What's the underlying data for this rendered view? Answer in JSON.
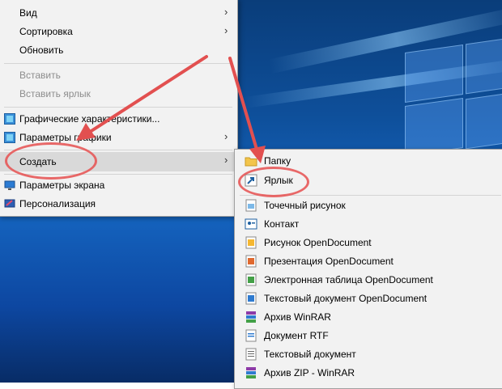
{
  "context_menu": {
    "items": [
      {
        "label": "Вид",
        "submenu": true,
        "disabled": false,
        "icon": null
      },
      {
        "label": "Сортировка",
        "submenu": true,
        "disabled": false,
        "icon": null
      },
      {
        "label": "Обновить",
        "submenu": false,
        "disabled": false,
        "icon": null
      },
      {
        "label": "Вставить",
        "submenu": false,
        "disabled": true,
        "icon": null
      },
      {
        "label": "Вставить ярлык",
        "submenu": false,
        "disabled": true,
        "icon": null
      },
      {
        "label": "Графические характеристики...",
        "submenu": false,
        "disabled": false,
        "icon": "intel-graphics-icon"
      },
      {
        "label": "Параметры графики",
        "submenu": true,
        "disabled": false,
        "icon": "intel-graphics-icon"
      },
      {
        "label": "Создать",
        "submenu": true,
        "disabled": false,
        "highlighted": true,
        "icon": null
      },
      {
        "label": "Параметры экрана",
        "submenu": false,
        "disabled": false,
        "icon": "display-icon"
      },
      {
        "label": "Персонализация",
        "submenu": false,
        "disabled": false,
        "icon": "personalization-icon"
      }
    ]
  },
  "create_submenu": {
    "items": [
      {
        "label": "Папку",
        "icon": "folder-icon"
      },
      {
        "label": "Ярлык",
        "icon": "shortcut-icon"
      },
      {
        "label": "Точечный рисунок",
        "icon": "bitmap-icon"
      },
      {
        "label": "Контакт",
        "icon": "contact-icon"
      },
      {
        "label": "Рисунок OpenDocument",
        "icon": "odg-icon"
      },
      {
        "label": "Презентация OpenDocument",
        "icon": "odp-icon"
      },
      {
        "label": "Электронная таблица OpenDocument",
        "icon": "ods-icon"
      },
      {
        "label": "Текстовый документ OpenDocument",
        "icon": "odt-icon"
      },
      {
        "label": "Архив WinRAR",
        "icon": "winrar-icon"
      },
      {
        "label": "Документ RTF",
        "icon": "rtf-icon"
      },
      {
        "label": "Текстовый документ",
        "icon": "txt-icon"
      },
      {
        "label": "Архив ZIP - WinRAR",
        "icon": "zip-winrar-icon"
      }
    ]
  },
  "colors": {
    "annotation": "#e25050",
    "menu_bg": "#f2f2f2",
    "highlight_bg": "#d9d9d9",
    "disabled_text": "#8d8d8d"
  }
}
